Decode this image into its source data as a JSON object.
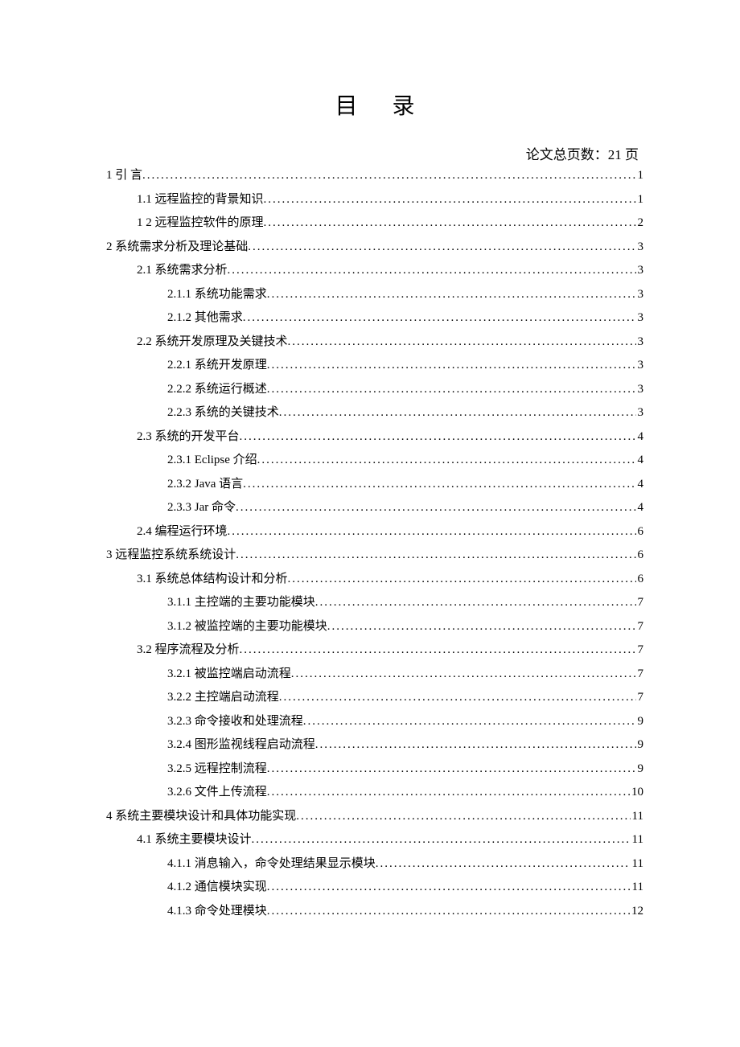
{
  "title": "目 录",
  "page_count_label": "论文总页数：21 页",
  "toc": [
    {
      "level": 1,
      "label": "1 引  言",
      "page": "1"
    },
    {
      "level": 2,
      "label": "1.1 远程监控的背景知识",
      "page": "1"
    },
    {
      "level": 2,
      "label": "1 2 远程监控软件的原理",
      "page": "2"
    },
    {
      "level": 1,
      "label": "2 系统需求分析及理论基础",
      "page": "3"
    },
    {
      "level": 2,
      "label": "2.1 系统需求分析",
      "page": "3"
    },
    {
      "level": 3,
      "label": "2.1.1 系统功能需求",
      "page": "3"
    },
    {
      "level": 3,
      "label": "2.1.2 其他需求",
      "page": "3"
    },
    {
      "level": 2,
      "label": "2.2 系统开发原理及关键技术",
      "page": "3"
    },
    {
      "level": 3,
      "label": "2.2.1 系统开发原理",
      "page": "3"
    },
    {
      "level": 3,
      "label": "2.2.2 系统运行概述",
      "page": "3"
    },
    {
      "level": 3,
      "label": "2.2.3 系统的关键技术",
      "page": "3"
    },
    {
      "level": 2,
      "label": "2.3 系统的开发平台",
      "page": "4"
    },
    {
      "level": 3,
      "label": "2.3.1 Eclipse 介绍",
      "page": "4"
    },
    {
      "level": 3,
      "label": "2.3.2 Java 语言",
      "page": "4"
    },
    {
      "level": 3,
      "label": "2.3.3 Jar 命令",
      "page": "4"
    },
    {
      "level": 2,
      "label": "2.4 编程运行环境",
      "page": "6"
    },
    {
      "level": 1,
      "label": "3 远程监控系统系统设计",
      "page": "6"
    },
    {
      "level": 2,
      "label": "3.1 系统总体结构设计和分析",
      "page": "6"
    },
    {
      "level": 3,
      "label": "3.1.1 主控端的主要功能模块",
      "page": "7"
    },
    {
      "level": 3,
      "label": "3.1.2 被监控端的主要功能模块",
      "page": "7"
    },
    {
      "level": 2,
      "label": "3.2 程序流程及分析",
      "page": "7"
    },
    {
      "level": 3,
      "label": "3.2.1 被监控端启动流程",
      "page": "7"
    },
    {
      "level": 3,
      "label": "3.2.2 主控端启动流程",
      "page": "7"
    },
    {
      "level": 3,
      "label": "3.2.3 命令接收和处理流程",
      "page": "9"
    },
    {
      "level": 3,
      "label": "3.2.4 图形监视线程启动流程",
      "page": "9"
    },
    {
      "level": 3,
      "label": "3.2.5 远程控制流程",
      "page": "9"
    },
    {
      "level": 3,
      "label": "3.2.6 文件上传流程",
      "page": "10"
    },
    {
      "level": 1,
      "label": "4 系统主要模块设计和具体功能实现",
      "page": "11"
    },
    {
      "level": 2,
      "label": "4.1 系统主要模块设计",
      "page": "11"
    },
    {
      "level": 3,
      "label": "4.1.1 消息输入，命令处理结果显示模块",
      "page": "11"
    },
    {
      "level": 3,
      "label": "4.1.2 通信模块实现",
      "page": "11"
    },
    {
      "level": 3,
      "label": "4.1.3 命令处理模块",
      "page": "12"
    }
  ]
}
